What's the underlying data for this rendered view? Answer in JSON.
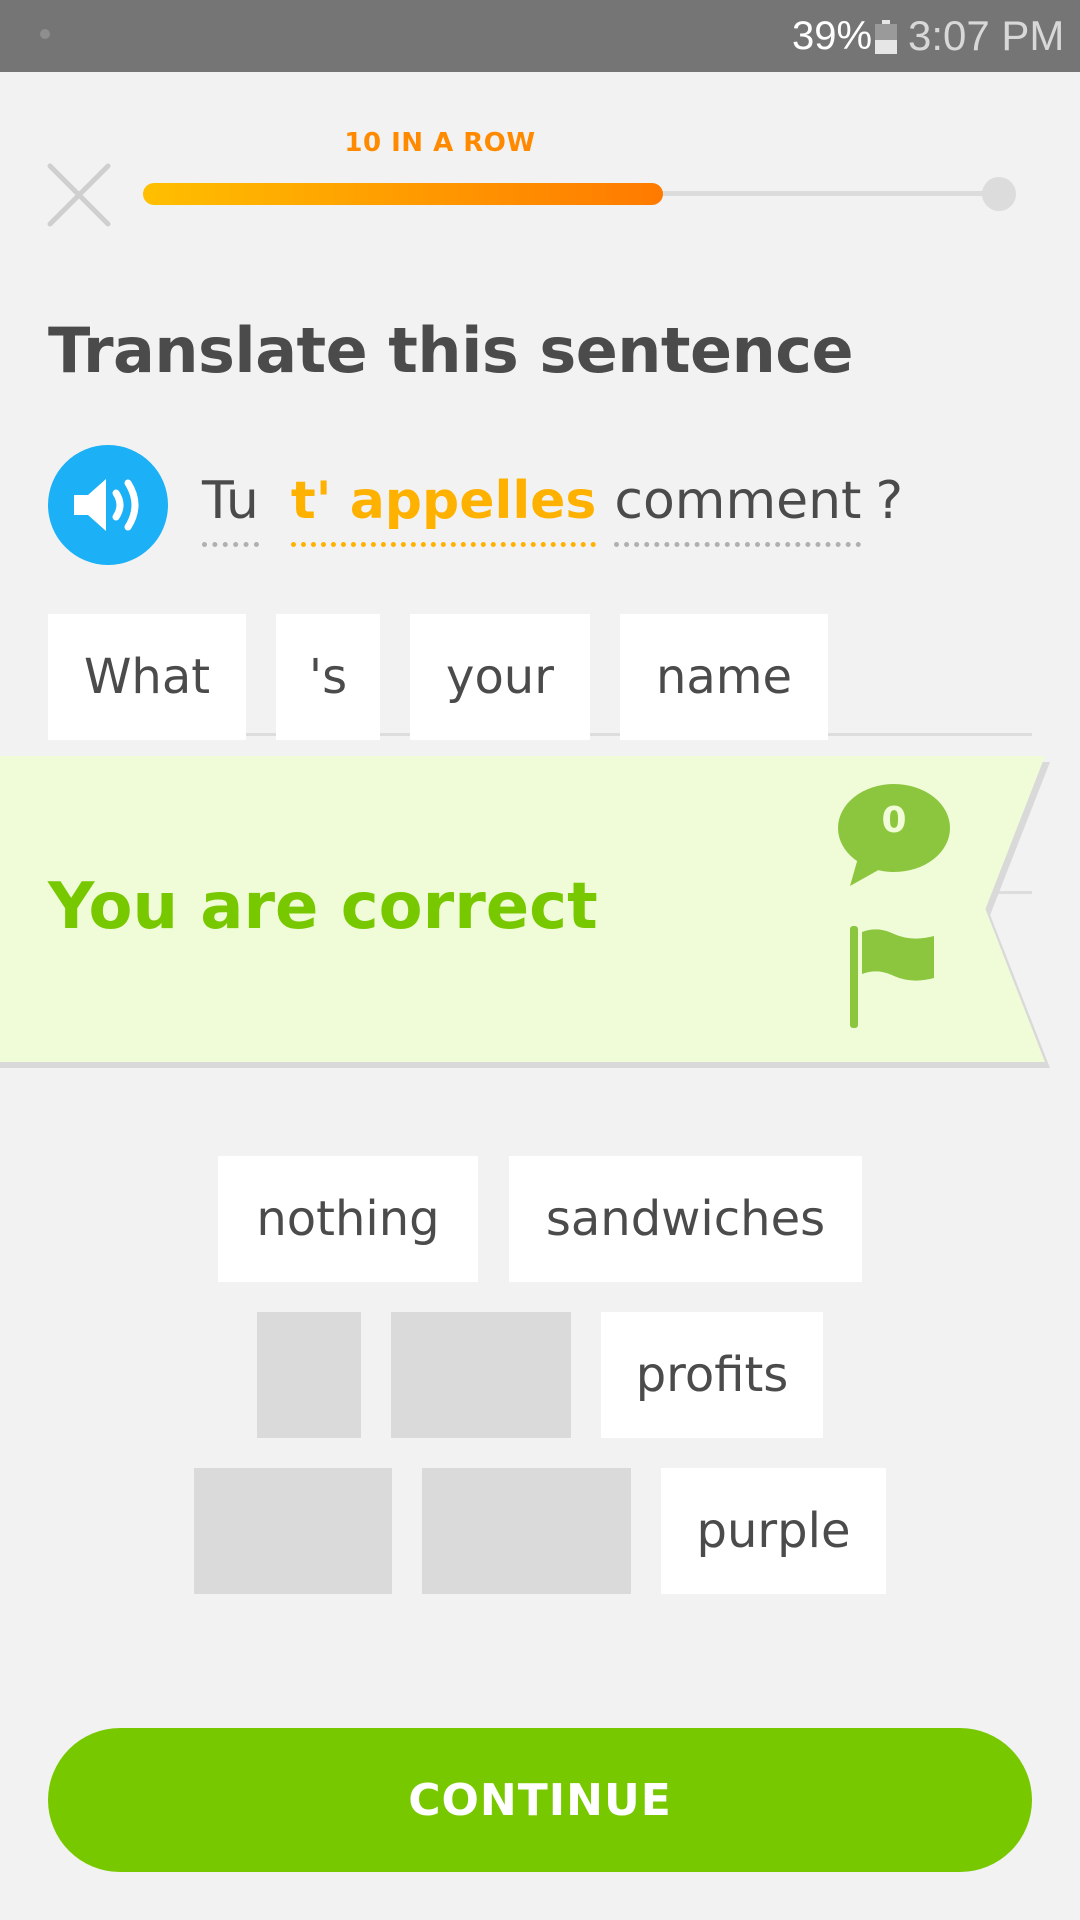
{
  "status_bar": {
    "battery_percent": "39%",
    "time": "3:07 PM"
  },
  "header": {
    "streak_label": "10 IN A ROW",
    "progress": 0.6,
    "colors": {
      "progress_start": "#ffbf00",
      "progress_end": "#ff7a00"
    }
  },
  "prompt": {
    "title": "Translate this sentence",
    "sentence": [
      {
        "text": "Tu",
        "highlight": false
      },
      {
        "text": "t' appelles",
        "highlight": true
      },
      {
        "text": "comment",
        "highlight": false
      },
      {
        "text": "?",
        "highlight": false,
        "punct": true
      }
    ]
  },
  "answer_tiles": [
    "What",
    "'s",
    "your",
    "name"
  ],
  "feedback": {
    "message": "You are correct",
    "comment_count": "0",
    "colors": {
      "banner_bg": "#f0fcd8",
      "accent": "#78c800",
      "icon": "#8cc63f"
    }
  },
  "word_bank": {
    "rows": [
      [
        {
          "text": "nothing",
          "used": false
        },
        {
          "text": "sandwiches",
          "used": false
        }
      ],
      [
        {
          "text": "",
          "used": true
        },
        {
          "text": "",
          "used": true
        },
        {
          "text": "profits",
          "used": false
        }
      ],
      [
        {
          "text": "",
          "used": true
        },
        {
          "text": "",
          "used": true
        },
        {
          "text": "purple",
          "used": false
        }
      ]
    ]
  },
  "footer": {
    "continue_label": "CONTINUE",
    "colors": {
      "button_bg": "#78c800"
    }
  },
  "icons": [
    "close-icon",
    "speaker-icon",
    "comment-icon",
    "flag-icon",
    "battery-icon"
  ]
}
